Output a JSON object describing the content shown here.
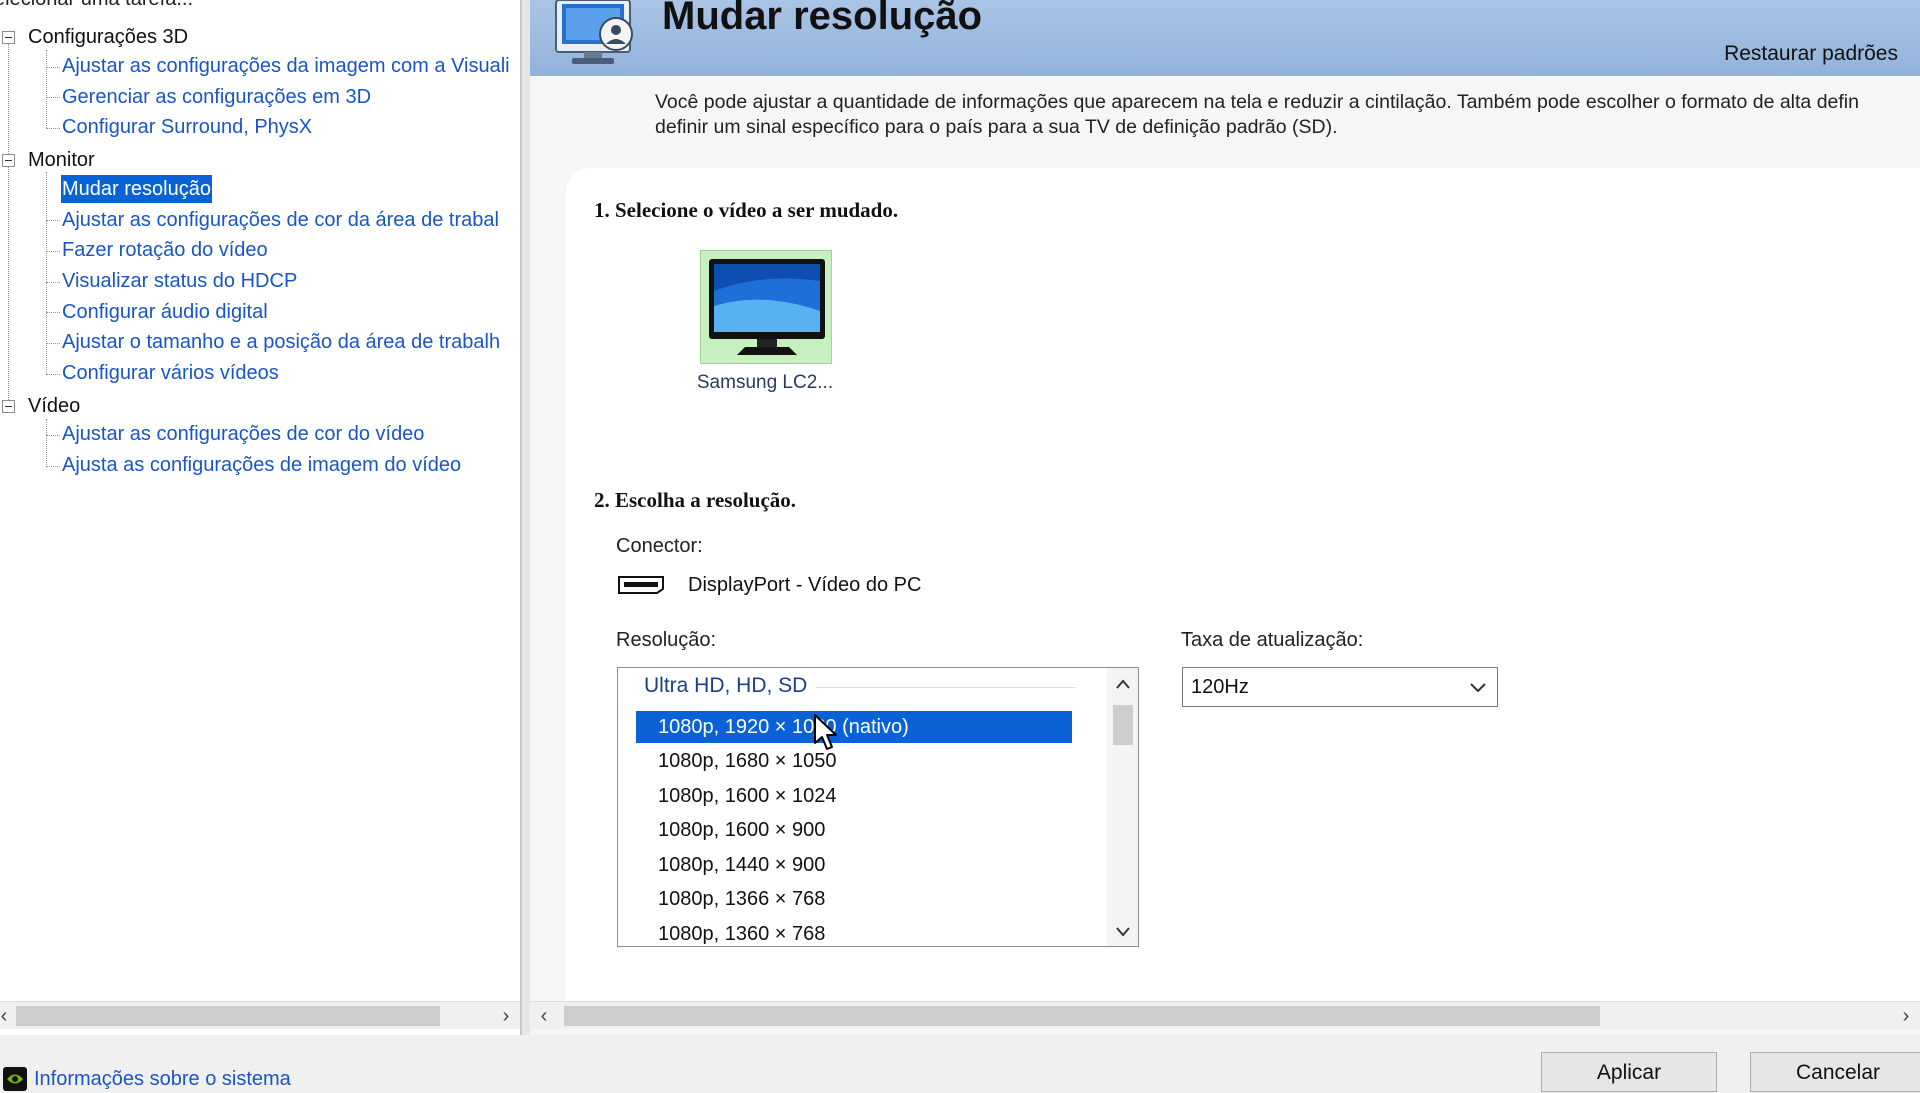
{
  "left_panel": {
    "title": "elecionar uma tarefa...",
    "categories": [
      {
        "label": "Configurações 3D",
        "items": [
          {
            "label": "Ajustar as configurações da imagem com a Visuali"
          },
          {
            "label": "Gerenciar as configurações em 3D"
          },
          {
            "label": "Configurar Surround, PhysX"
          }
        ]
      },
      {
        "label": "Monitor",
        "items": [
          {
            "label": "Mudar resolução",
            "selected": true
          },
          {
            "label": "Ajustar as configurações de cor da área de trabal"
          },
          {
            "label": "Fazer rotação do vídeo"
          },
          {
            "label": "Visualizar status do HDCP"
          },
          {
            "label": "Configurar áudio digital"
          },
          {
            "label": "Ajustar o tamanho e a posição da área de trabalh"
          },
          {
            "label": "Configurar vários vídeos"
          }
        ]
      },
      {
        "label": "Vídeo",
        "items": [
          {
            "label": "Ajustar as configurações de cor do vídeo"
          },
          {
            "label": "Ajusta as configurações de imagem do vídeo"
          }
        ]
      }
    ]
  },
  "header": {
    "title": "Mudar resolução",
    "restore_defaults": "Restaurar padrões",
    "description_line1": "Você pode ajustar a quantidade de informações que aparecem na tela e reduzir  a cintilação. Também pode escolher o formato de alta defin",
    "description_line2": "definir um sinal específico para o país para a sua TV de definição padrão (SD)."
  },
  "step1": {
    "heading": "1. Selecione o vídeo a ser mudado.",
    "display_name": "Samsung LC2..."
  },
  "step2": {
    "heading": "2. Escolha a resolução.",
    "connector_label": "Conector:",
    "connector_value": "DisplayPort - Vídeo do PC",
    "resolution_label": "Resolução:",
    "resolution_group": "Ultra HD, HD, SD",
    "resolutions": [
      "1080p, 1920 × 1080 (nativo)",
      "1080p, 1680 × 1050",
      "1080p, 1600 × 1024",
      "1080p, 1600 × 900",
      "1080p, 1440 × 900",
      "1080p, 1366 × 768",
      "1080p, 1360 × 768"
    ],
    "selected_resolution_index": 0,
    "refresh_label": "Taxa de atualização:",
    "refresh_value": "120Hz"
  },
  "footer": {
    "system_info": "Informações sobre o sistema",
    "apply": "Aplicar",
    "cancel": "Cancelar"
  },
  "colors": {
    "selection": "#0a63d6",
    "link": "#1a55c8",
    "banner": "#a9c4e6"
  }
}
